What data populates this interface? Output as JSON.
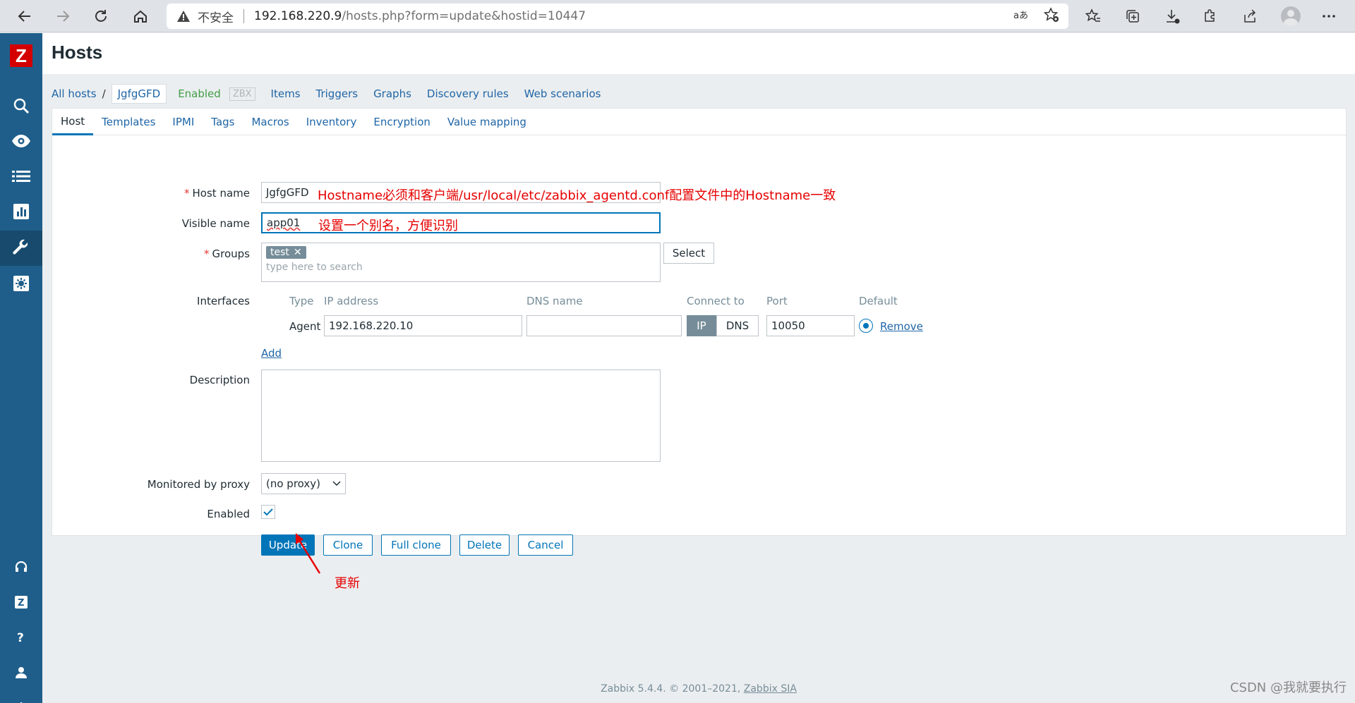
{
  "browser": {
    "insecure_label": "不安全",
    "url_host": "192.168.220.9",
    "url_path": "/hosts.php?form=update&hostid=10447"
  },
  "page": {
    "title": "Hosts"
  },
  "breadcrumb": {
    "all_hosts": "All hosts",
    "separator": "/",
    "current_host": "JgfgGFD",
    "status": "Enabled",
    "zbx_badge": "ZBX",
    "links": [
      "Items",
      "Triggers",
      "Graphs",
      "Discovery rules",
      "Web scenarios"
    ]
  },
  "tabs": [
    "Host",
    "Templates",
    "IPMI",
    "Tags",
    "Macros",
    "Inventory",
    "Encryption",
    "Value mapping"
  ],
  "form": {
    "host_name_label": "Host name",
    "host_name_value": "JgfgGFD",
    "visible_name_label": "Visible name",
    "visible_name_value": "app01",
    "groups_label": "Groups",
    "group_tag": "test",
    "groups_placeholder": "type here to search",
    "select_button": "Select",
    "interfaces_label": "Interfaces",
    "interfaces_headers": {
      "type": "Type",
      "ip": "IP address",
      "dns": "DNS name",
      "connect": "Connect to",
      "port": "Port",
      "default": "Default"
    },
    "interface": {
      "type": "Agent",
      "ip": "192.168.220.10",
      "dns": "",
      "connect_ip": "IP",
      "connect_dns": "DNS",
      "port": "10050",
      "remove": "Remove"
    },
    "add_link": "Add",
    "description_label": "Description",
    "proxy_label": "Monitored by proxy",
    "proxy_value": "(no proxy)",
    "enabled_label": "Enabled",
    "buttons": {
      "update": "Update",
      "clone": "Clone",
      "full_clone": "Full clone",
      "delete": "Delete",
      "cancel": "Cancel"
    }
  },
  "annotations": {
    "host_name_note": "Hostname必须和客户端/usr/local/etc/zabbix_agentd.conf配置文件中的Hostname一致",
    "visible_name_note": "设置一个别名，方便识别",
    "update_note": "更新"
  },
  "footer": {
    "text": "Zabbix 5.4.4. © 2001–2021,",
    "company": "Zabbix SIA"
  },
  "watermark": "CSDN @我就要执行",
  "colors": {
    "sidebar": "#1f5e8a",
    "accent": "#0275b8",
    "annotation": "#e60000",
    "enabled_status": "#429e47"
  }
}
